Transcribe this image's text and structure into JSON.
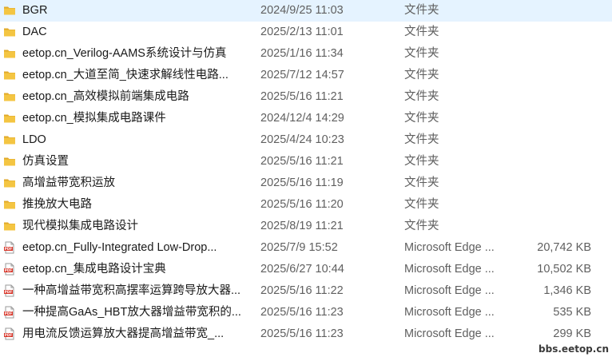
{
  "files": [
    {
      "name": "BGR",
      "date": "2024/9/25 11:03",
      "type": "文件夹",
      "size": "",
      "icon": "folder-icon"
    },
    {
      "name": "DAC",
      "date": "2025/2/13 11:01",
      "type": "文件夹",
      "size": "",
      "icon": "folder-icon"
    },
    {
      "name": "eetop.cn_Verilog-AAMS系统设计与仿真",
      "date": "2025/1/16 11:34",
      "type": "文件夹",
      "size": "",
      "icon": "folder-icon"
    },
    {
      "name": "eetop.cn_大道至简_快速求解线性电路...",
      "date": "2025/7/12 14:57",
      "type": "文件夹",
      "size": "",
      "icon": "folder-icon"
    },
    {
      "name": "eetop.cn_高效模拟前端集成电路",
      "date": "2025/5/16 11:21",
      "type": "文件夹",
      "size": "",
      "icon": "folder-icon"
    },
    {
      "name": "eetop.cn_模拟集成电路课件",
      "date": "2024/12/4 14:29",
      "type": "文件夹",
      "size": "",
      "icon": "folder-icon"
    },
    {
      "name": "LDO",
      "date": "2025/4/24 10:23",
      "type": "文件夹",
      "size": "",
      "icon": "folder-icon"
    },
    {
      "name": "仿真设置",
      "date": "2025/5/16 11:21",
      "type": "文件夹",
      "size": "",
      "icon": "folder-icon"
    },
    {
      "name": "高增益带宽积运放",
      "date": "2025/5/16 11:19",
      "type": "文件夹",
      "size": "",
      "icon": "folder-icon"
    },
    {
      "name": "推挽放大电路",
      "date": "2025/5/16 11:20",
      "type": "文件夹",
      "size": "",
      "icon": "folder-icon"
    },
    {
      "name": "现代模拟集成电路设计",
      "date": "2025/8/19 11:21",
      "type": "文件夹",
      "size": "",
      "icon": "folder-icon"
    },
    {
      "name": "eetop.cn_Fully-Integrated Low-Drop...",
      "date": "2025/7/9 15:52",
      "type": "Microsoft Edge ...",
      "size": "20,742 KB",
      "icon": "pdf-icon"
    },
    {
      "name": "eetop.cn_集成电路设计宝典",
      "date": "2025/6/27 10:44",
      "type": "Microsoft Edge ...",
      "size": "10,502 KB",
      "icon": "pdf-icon"
    },
    {
      "name": "一种高增益带宽积高摆率运算跨导放大器...",
      "date": "2025/5/16 11:22",
      "type": "Microsoft Edge ...",
      "size": "1,346 KB",
      "icon": "pdf-icon"
    },
    {
      "name": "一种提高GaAs_HBT放大器增益带宽积的...",
      "date": "2025/5/16 11:23",
      "type": "Microsoft Edge ...",
      "size": "535 KB",
      "icon": "pdf-icon"
    },
    {
      "name": "用电流反馈运算放大器提高增益带宽_...",
      "date": "2025/5/16 11:23",
      "type": "Microsoft Edge ...",
      "size": "299 KB",
      "icon": "pdf-icon"
    }
  ],
  "watermark": "bbs.eetop.cn",
  "colors": {
    "folder": "#f4c542",
    "folder_dark": "#e0a92a",
    "pdf": "#d9372b",
    "hover": "#e5f3ff"
  }
}
